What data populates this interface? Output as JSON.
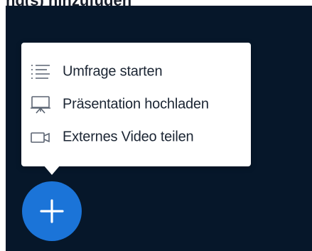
{
  "header": {
    "title_fragment": "ng(s) hinzufügen"
  },
  "actions_menu": {
    "items": [
      {
        "label": "Umfrage starten",
        "icon": "list-icon"
      },
      {
        "label": "Präsentation hochladen",
        "icon": "presentation-icon"
      },
      {
        "label": "Externes Video teilen",
        "icon": "video-icon"
      }
    ]
  },
  "fab": {
    "icon": "plus-icon",
    "color": "#1b74d8"
  },
  "colors": {
    "panel_background": "#06172a",
    "menu_background": "#ffffff",
    "text": "#1b2533",
    "icon_stroke": "#5b6472"
  }
}
